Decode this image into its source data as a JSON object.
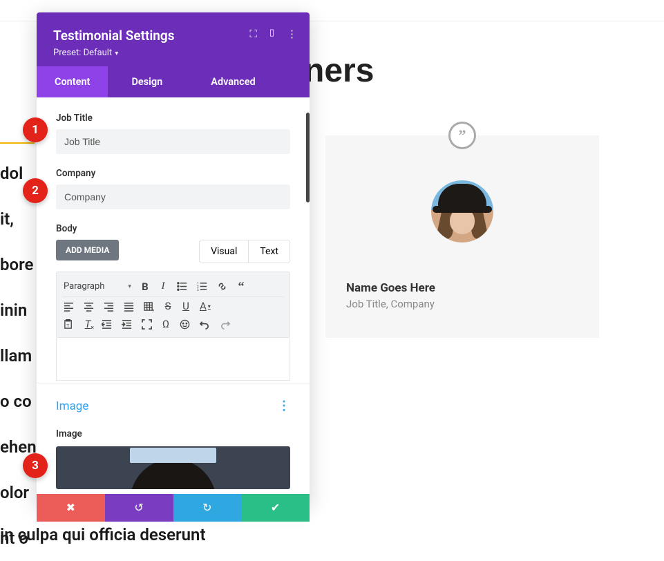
{
  "background": {
    "title_fragment": "ners",
    "lines": [
      " dol",
      "it,",
      "bore",
      "inin",
      "llam",
      "o co",
      "ehen",
      "olor",
      "nt o",
      "in culpa qui officia deserunt"
    ]
  },
  "panel": {
    "title": "Testimonial Settings",
    "preset": "Preset: Default",
    "tabs": {
      "content": "Content",
      "design": "Design",
      "advanced": "Advanced"
    }
  },
  "fields": {
    "job_title_label": "Job Title",
    "job_title_value": "Job Title",
    "company_label": "Company",
    "company_value": "Company",
    "body_label": "Body",
    "add_media": "ADD MEDIA",
    "visual": "Visual",
    "text": "Text",
    "paragraph": "Paragraph"
  },
  "section_image": {
    "title": "Image",
    "label": "Image"
  },
  "callouts": {
    "one": "1",
    "two": "2",
    "three": "3"
  },
  "preview": {
    "name": "Name Goes Here",
    "job": "Job Title, Company"
  }
}
